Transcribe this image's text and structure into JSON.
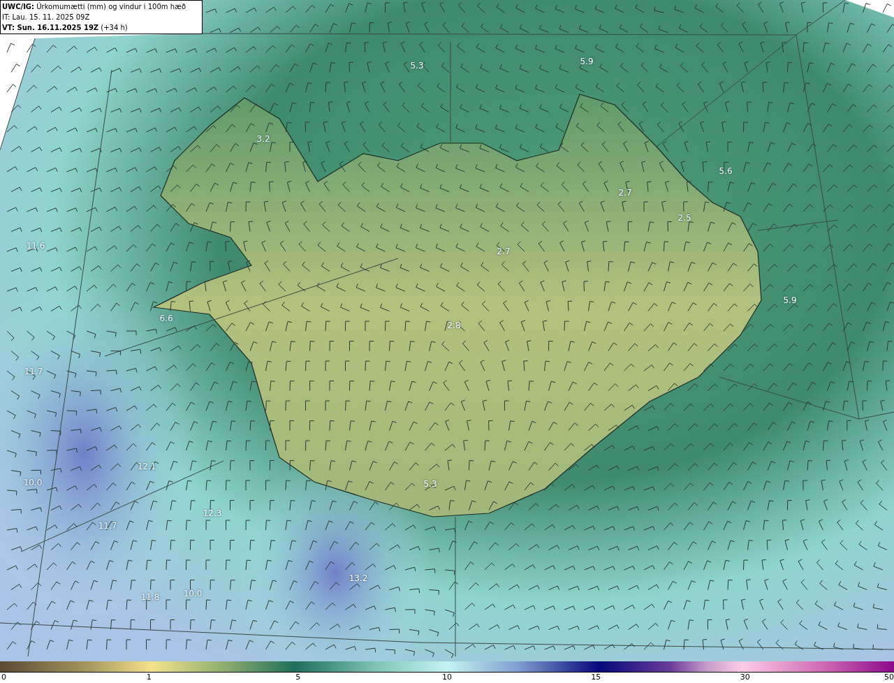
{
  "header": {
    "title": "**UWC/IG:** Úrkomumætti (mm) og vindur i 100m hæð",
    "issue_time": "IT: Lau. 15. 11. 2025 09Z",
    "valid_time": "**VT: Sun. 16.11.2025 19Z** (+34 h)"
  },
  "map": {
    "value_labels": [
      "5.3",
      "5.9",
      "3.2",
      "5.6",
      "2.7",
      "2.5",
      "2.7",
      "5.9",
      "2.8",
      "5.3",
      "11.6",
      "6.6",
      "11.7",
      "12.1",
      "10.0",
      "12.3",
      "11.7",
      "13.2",
      "11.8",
      "10.0"
    ]
  },
  "colorbar": {
    "ticks": [
      "0",
      "1",
      "5",
      "10",
      "15",
      "30",
      "50"
    ]
  }
}
